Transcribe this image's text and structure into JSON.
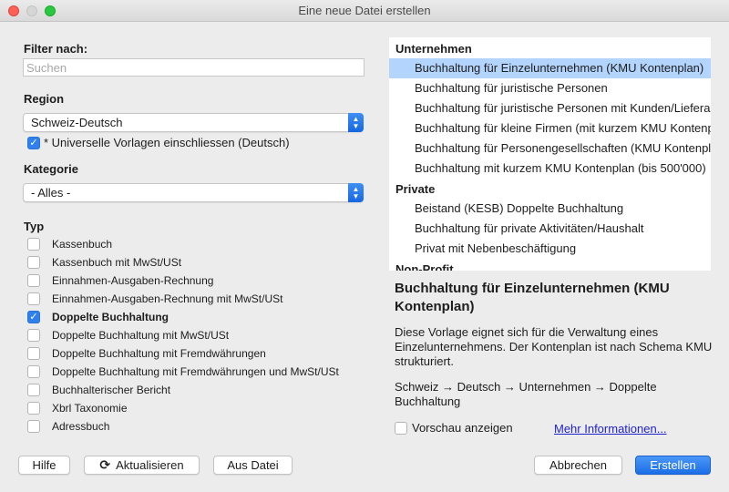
{
  "window": {
    "title": "Eine neue Datei erstellen"
  },
  "filter": {
    "label": "Filter nach:",
    "placeholder": "Suchen",
    "value": ""
  },
  "region": {
    "label": "Region",
    "selected": "Schweiz-Deutsch",
    "universal_checkbox": {
      "label": "* Universelle Vorlagen einschliessen (Deutsch)",
      "checked": true
    }
  },
  "kategorie": {
    "label": "Kategorie",
    "selected": "- Alles -"
  },
  "typ": {
    "label": "Typ",
    "items": [
      {
        "label": "Kassenbuch",
        "checked": false
      },
      {
        "label": "Kassenbuch mit MwSt/USt",
        "checked": false
      },
      {
        "label": "Einnahmen-Ausgaben-Rechnung",
        "checked": false
      },
      {
        "label": "Einnahmen-Ausgaben-Rechnung mit MwSt/USt",
        "checked": false
      },
      {
        "label": "Doppelte Buchhaltung",
        "checked": true
      },
      {
        "label": "Doppelte Buchhaltung mit MwSt/USt",
        "checked": false
      },
      {
        "label": "Doppelte Buchhaltung mit Fremdwährungen",
        "checked": false
      },
      {
        "label": "Doppelte Buchhaltung mit Fremdwährungen und MwSt/USt",
        "checked": false
      },
      {
        "label": "Buchhalterischer Bericht",
        "checked": false
      },
      {
        "label": "Xbrl Taxonomie",
        "checked": false
      },
      {
        "label": "Adressbuch",
        "checked": false
      }
    ]
  },
  "templates": {
    "groups": [
      {
        "name": "Unternehmen",
        "items": [
          "Buchhaltung für Einzelunternehmen (KMU Kontenplan)",
          "Buchhaltung für juristische Personen",
          "Buchhaltung für juristische Personen mit Kunden/Lieferanten",
          "Buchhaltung für kleine Firmen (mit kurzem KMU Kontenplan)",
          "Buchhaltung für Personengesellschaften (KMU Kontenplan)",
          "Buchhaltung mit kurzem KMU Kontenplan (bis 500'000)"
        ]
      },
      {
        "name": "Private",
        "items": [
          " Beistand (KESB) Doppelte Buchhaltung",
          "Buchhaltung für private Aktivitäten/Haushalt",
          "Privat mit Nebenbeschäftigung"
        ]
      },
      {
        "name": "Non-Profit",
        "items": []
      }
    ],
    "selected": "Buchhaltung für Einzelunternehmen (KMU Kontenplan)"
  },
  "detail": {
    "title": "Buchhaltung für Einzelunternehmen (KMU Kontenplan)",
    "description": "Diese Vorlage eignet sich für die Verwaltung eines Einzelunternehmens. Der Kontenplan ist nach Schema KMU strukturiert.",
    "path": "Schweiz → Deutsch → Unternehmen → Doppelte Buchhaltung",
    "preview_checkbox": {
      "label": "Vorschau anzeigen",
      "checked": false
    },
    "more_link": "Mehr Informationen..."
  },
  "buttons": {
    "help": "Hilfe",
    "refresh": "Aktualisieren",
    "from_file": "Aus Datei",
    "cancel": "Abbrechen",
    "create": "Erstellen"
  },
  "colors": {
    "selection": "#b3d4fc",
    "accent": "#1b6ee6",
    "link": "#2222cc"
  }
}
